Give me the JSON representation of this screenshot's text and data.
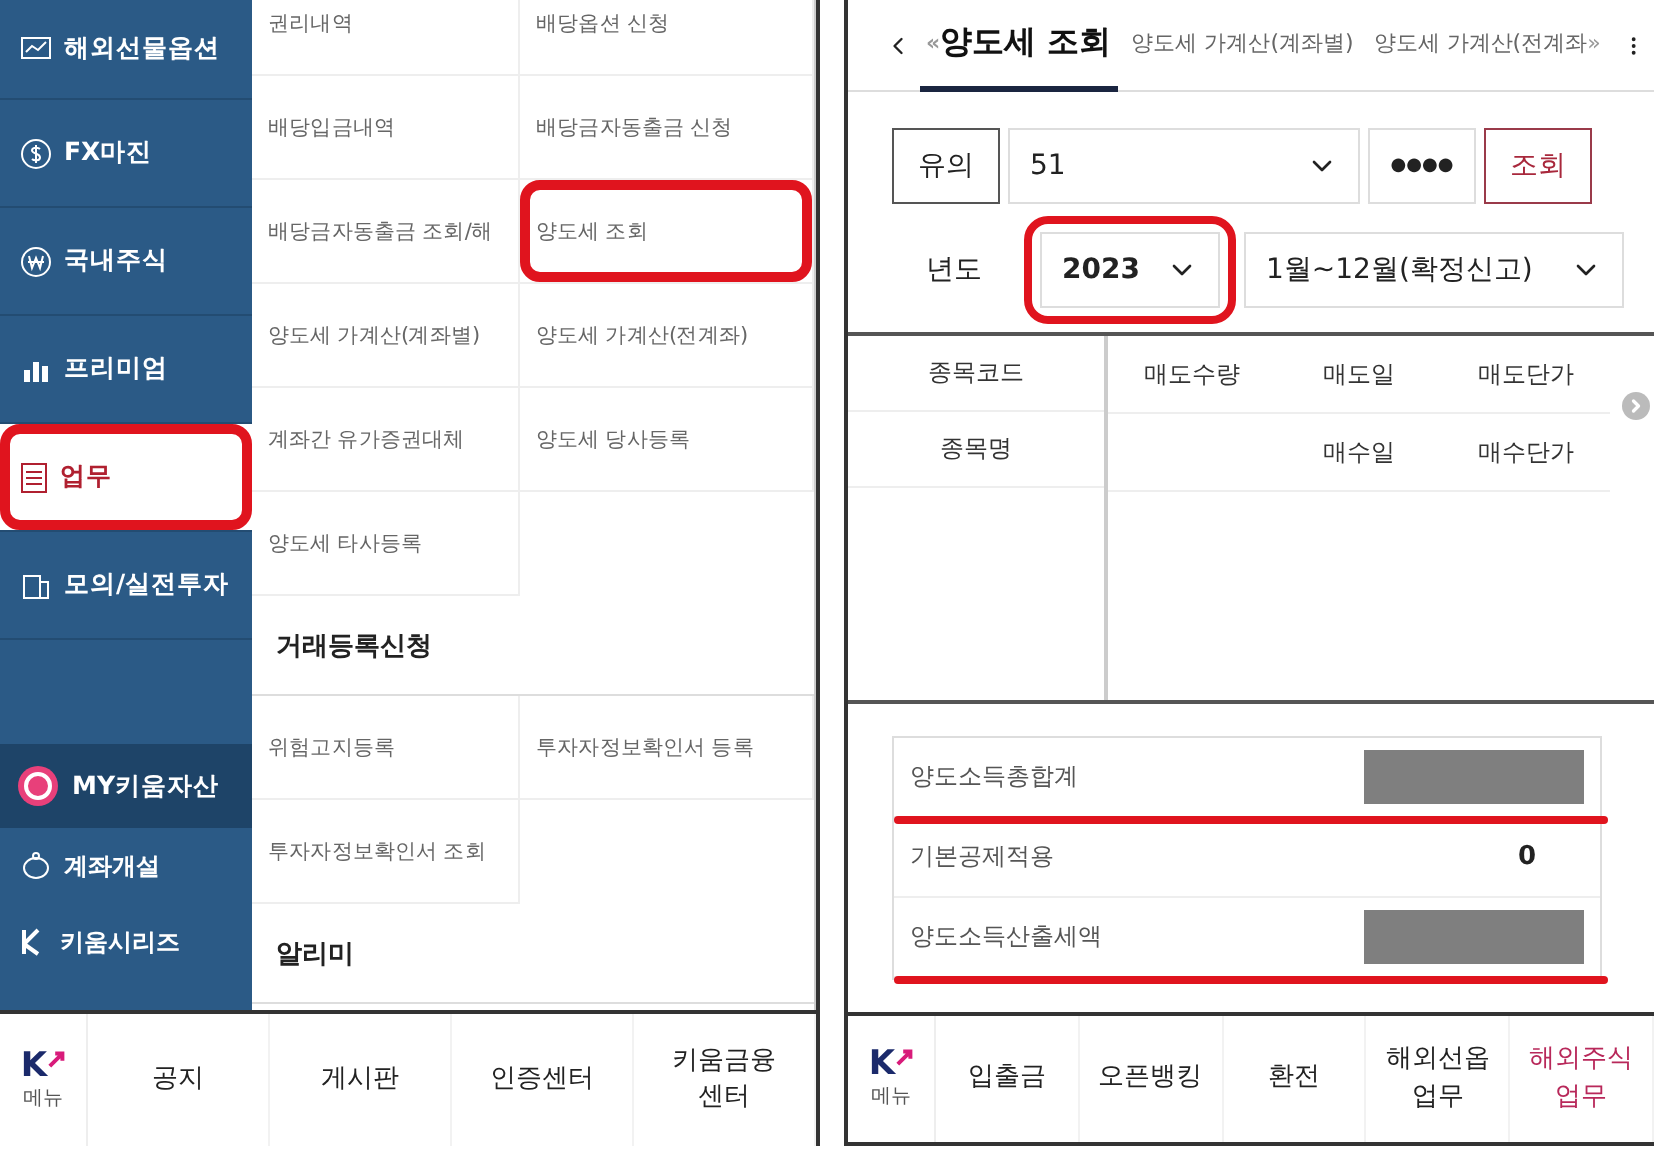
{
  "left_screen": {
    "sidebar": {
      "items": [
        {
          "label": "해외선물옵션",
          "selected": false,
          "highlighted": false
        },
        {
          "label": "FX마진",
          "selected": false,
          "highlighted": false
        },
        {
          "label": "국내주식",
          "selected": false,
          "highlighted": false
        },
        {
          "label": "프리미엄",
          "selected": false,
          "highlighted": false
        },
        {
          "label": "업무",
          "selected": true,
          "highlighted": true
        },
        {
          "label": "모의/실전투자",
          "selected": false,
          "highlighted": false
        }
      ],
      "my_assets": {
        "label": "MY키움자산"
      },
      "links": [
        {
          "label": "계좌개설"
        },
        {
          "label": "키움시리즈"
        }
      ]
    },
    "menu": [
      {
        "kind": "grid",
        "items": [
          {
            "label": "권리내역",
            "highlighted": false
          },
          {
            "label": "배당옵션 신청",
            "highlighted": false
          },
          {
            "label": "배당입금내역",
            "highlighted": false
          },
          {
            "label": "배당금자동출금 신청",
            "highlighted": false
          },
          {
            "label": "배당금자동출금 조회/해",
            "highlighted": false
          },
          {
            "label": "양도세 조회",
            "highlighted": true
          },
          {
            "label": "양도세 가계산(계좌별)",
            "highlighted": false
          },
          {
            "label": "양도세 가계산(전계좌)",
            "highlighted": false
          },
          {
            "label": "계좌간 유가증권대체",
            "highlighted": false
          },
          {
            "label": "양도세 당사등록",
            "highlighted": false
          },
          {
            "label": "양도세 타사등록",
            "highlighted": false
          }
        ]
      },
      {
        "kind": "heading",
        "label": "거래등록신청"
      },
      {
        "kind": "grid",
        "items": [
          {
            "label": "위험고지등록",
            "highlighted": false
          },
          {
            "label": "투자자정보확인서 등록",
            "highlighted": false
          },
          {
            "label": "투자자정보확인서 조회",
            "highlighted": false
          }
        ]
      },
      {
        "kind": "heading",
        "label": "알리미"
      }
    ],
    "bottom_nav": {
      "logo_text": "K",
      "menu_label": "메뉴",
      "tabs": [
        {
          "label": "공지",
          "selected": false
        },
        {
          "label": "게시판",
          "selected": false
        },
        {
          "label": "인증센터",
          "selected": false
        },
        {
          "label": "키움금융 센터",
          "selected": false
        }
      ]
    }
  },
  "right_screen": {
    "header": {
      "scroll_left": "«",
      "scroll_right": "»",
      "tabs": [
        {
          "label": "양도세 조회",
          "selected": true
        },
        {
          "label": "양도세 가계산(계좌별)",
          "selected": false
        },
        {
          "label": "양도세 가계산(전계좌",
          "selected": false
        }
      ]
    },
    "notice_button": "유의",
    "account": {
      "value": "51"
    },
    "password": {
      "value": "●●●●"
    },
    "search_button": "조회",
    "year_label": "년도",
    "year": {
      "value": "2023",
      "highlighted": true
    },
    "period": {
      "value": "1월~12월(확정신고)",
      "highlighted": false
    },
    "table": {
      "left_headers": [
        "종목코드",
        "종목명"
      ],
      "right_headers": [
        [
          "매도수량",
          "매도일",
          "매도단가"
        ],
        [
          "매수일",
          "매수단가"
        ]
      ]
    },
    "summary": [
      {
        "label": "양도소득총합계",
        "kind": "masked",
        "underlined": true
      },
      {
        "label": "기본공제적용",
        "kind": "value",
        "value": "0",
        "underlined": false
      },
      {
        "label": "양도소득산출세액",
        "kind": "masked",
        "underlined": true
      }
    ],
    "bottom_nav": {
      "logo_text": "K",
      "menu_label": "메뉴",
      "tabs": [
        {
          "label": "입출금",
          "selected": false
        },
        {
          "label": "오픈뱅킹",
          "selected": false
        },
        {
          "label": "환전",
          "selected": false
        },
        {
          "label": "해외선옵 업무",
          "selected": false
        },
        {
          "label": "해외주식 업무",
          "selected": true
        }
      ]
    }
  }
}
